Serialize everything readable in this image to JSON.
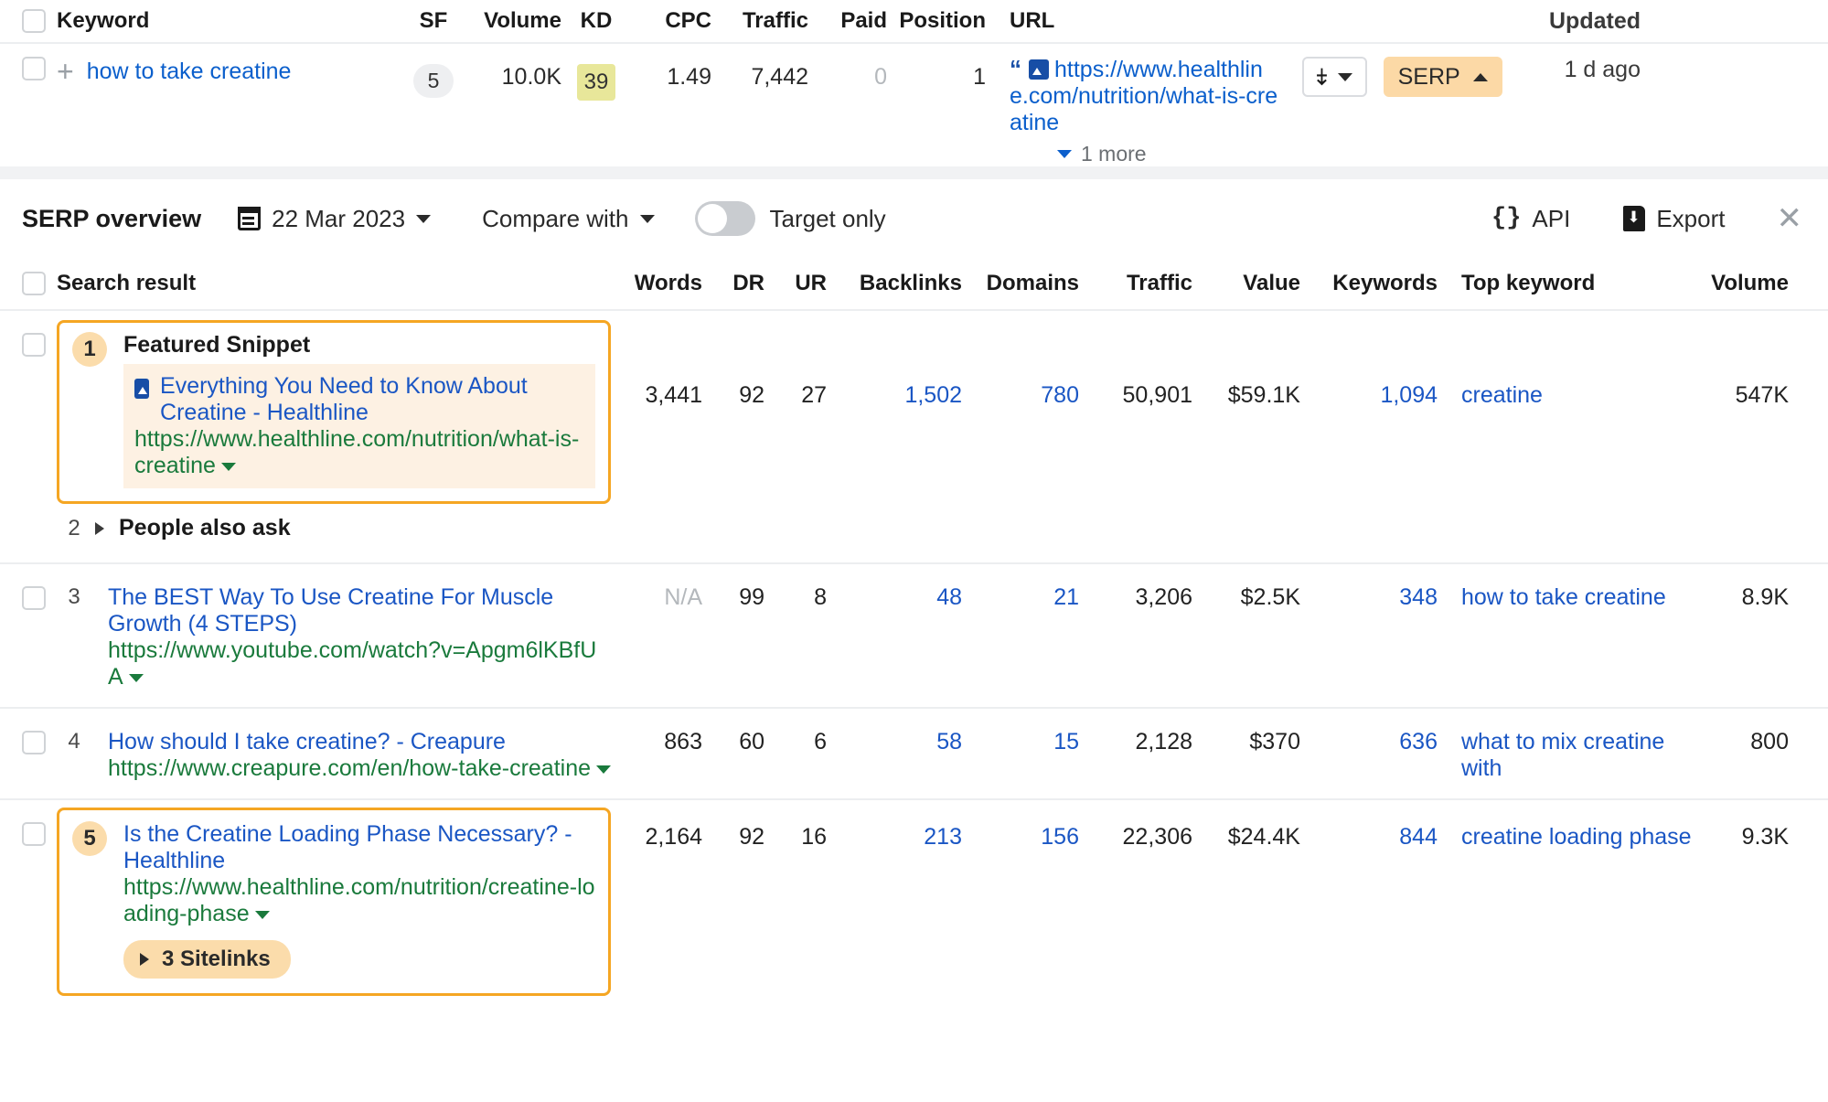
{
  "keyword_table": {
    "headers": {
      "keyword": "Keyword",
      "sf": "SF",
      "volume": "Volume",
      "kd": "KD",
      "cpc": "CPC",
      "traffic": "Traffic",
      "paid": "Paid",
      "position": "Position",
      "url": "URL",
      "updated": "Updated"
    },
    "row": {
      "keyword": "how to take creatine",
      "sf": "5",
      "volume": "10.0K",
      "kd": "39",
      "cpc": "1.49",
      "traffic": "7,442",
      "paid": "0",
      "position": "1",
      "url": "https://www.healthline.com/nutrition/what-is-creatine",
      "more_label": "1 more",
      "serp_button": "SERP",
      "updated": "1 d ago"
    }
  },
  "serp_toolbar": {
    "title": "SERP overview",
    "date": "22 Mar 2023",
    "compare_label": "Compare with",
    "target_only_label": "Target only",
    "target_only_on": false,
    "api_label": "API",
    "export_label": "Export"
  },
  "serp_table": {
    "headers": {
      "search_result": "Search result",
      "words": "Words",
      "dr": "DR",
      "ur": "UR",
      "backlinks": "Backlinks",
      "domains": "Domains",
      "traffic": "Traffic",
      "value": "Value",
      "keywords": "Keywords",
      "top_keyword": "Top keyword",
      "volume": "Volume"
    },
    "rows": [
      {
        "rank": "1",
        "type": "featured_snippet",
        "highlighted": true,
        "feature_label": "Featured Snippet",
        "title": "Everything You Need to Know About Creatine - Healthline",
        "url": "https://www.healthline.com/nutrition/what-is-creatine",
        "words": "3,441",
        "dr": "92",
        "ur": "27",
        "backlinks": "1,502",
        "domains": "780",
        "traffic": "50,901",
        "value": "$59.1K",
        "keywords": "1,094",
        "top_keyword": "creatine",
        "volume": "547K"
      },
      {
        "rank": "2",
        "type": "people_also_ask",
        "highlighted": false,
        "feature_label": "People also ask",
        "title": "",
        "url": "",
        "words": "",
        "dr": "",
        "ur": "",
        "backlinks": "",
        "domains": "",
        "traffic": "",
        "value": "",
        "keywords": "",
        "top_keyword": "",
        "volume": ""
      },
      {
        "rank": "3",
        "type": "organic",
        "highlighted": false,
        "feature_label": "",
        "title": "The BEST Way To Use Creatine For Muscle Growth (4 STEPS)",
        "url": "https://www.youtube.com/watch?v=Apgm6lKBfUA",
        "words": "N/A",
        "dr": "99",
        "ur": "8",
        "backlinks": "48",
        "domains": "21",
        "traffic": "3,206",
        "value": "$2.5K",
        "keywords": "348",
        "top_keyword": "how to take creatine",
        "volume": "8.9K"
      },
      {
        "rank": "4",
        "type": "organic",
        "highlighted": false,
        "feature_label": "",
        "title": "How should I take creatine? - Creapure",
        "url": "https://www.creapure.com/en/how-take-creatine",
        "words": "863",
        "dr": "60",
        "ur": "6",
        "backlinks": "58",
        "domains": "15",
        "traffic": "2,128",
        "value": "$370",
        "keywords": "636",
        "top_keyword": "what to mix creatine with",
        "volume": "800"
      },
      {
        "rank": "5",
        "type": "organic",
        "highlighted": true,
        "feature_label": "",
        "title": "Is the Creatine Loading Phase Necessary? - Healthline",
        "url": "https://www.healthline.com/nutrition/creatine-loading-phase",
        "sitelinks_label": "3 Sitelinks",
        "words": "2,164",
        "dr": "92",
        "ur": "16",
        "backlinks": "213",
        "domains": "156",
        "traffic": "22,306",
        "value": "$24.4K",
        "keywords": "844",
        "top_keyword": "creatine loading phase",
        "volume": "9.3K"
      }
    ]
  },
  "colors": {
    "link_blue": "#1a56c4",
    "url_green": "#1a7a3c",
    "highlight_orange": "#f5a623",
    "badge_peach": "#fbdcab",
    "kd_yellow": "#e8e79a"
  }
}
